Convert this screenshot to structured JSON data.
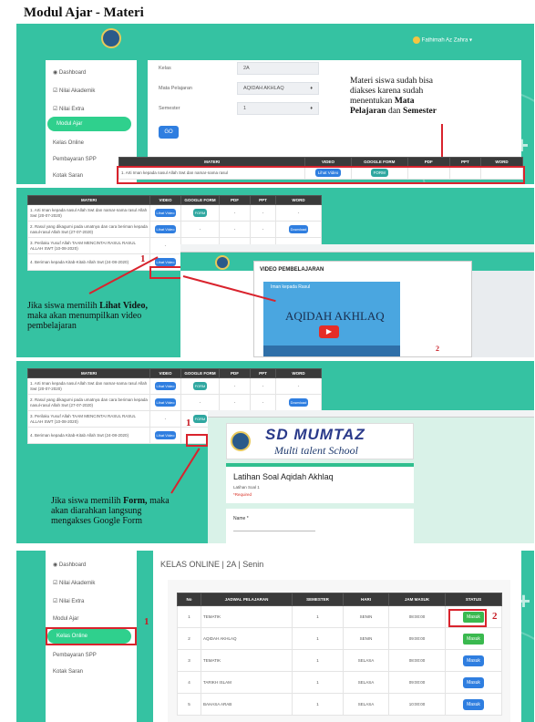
{
  "doc_title": "Modul Ajar - Materi",
  "panel1": {
    "user_name": "Fathimah Az Zahra",
    "sidebar": [
      "Dashboard",
      "Nilai Akademik",
      "Nilai Extra",
      "Modul Ajar",
      "Kelas Online",
      "Pembayaran SPP",
      "Kotak Saran"
    ],
    "fields": {
      "kelas_label": "Kelas",
      "kelas_value": "2A",
      "mapel_label": "Mata Pelajaran",
      "mapel_value": "AQIDAH AKHLAQ",
      "semester_label": "Semester",
      "semester_value": "1"
    },
    "go_label": "GO",
    "caption_line1": "Materi siswa sudah bisa",
    "caption_line2": "diakses karena sudah",
    "caption_line3": "menentukan",
    "caption_bold1": "Mata",
    "caption_bold2": "Pelajaran",
    "caption_dan": "dan",
    "caption_bold3": "Semester",
    "table_headers": [
      "MATERI",
      "VIDEO",
      "GOOGLE FORM",
      "PDF",
      "PPT",
      "WORD"
    ],
    "row1_materi": "1. Arti Iman kepada nasul Allah Swt dan namar-nama rasul",
    "row1_video": "Lihat Video",
    "row1_form": "FORM"
  },
  "panel2": {
    "table_headers": [
      "MATERI",
      "VIDEO",
      "GOOGLE FORM",
      "PDF",
      "PPT",
      "WORD"
    ],
    "rows": [
      {
        "materi": "1. Arti Iman kepada nasul Allah Swt dan namar-nama rasul Allah Swt (20-07-2020)",
        "video": "Lihat Video",
        "form": "FORM",
        "pdf": "-",
        "ppt": "-",
        "word": "-"
      },
      {
        "materi": "2. Rasul yang dikagumi pada umatnya dan cara beriman kepada nasul-rasul Allah Swt (27-07-2020)",
        "video": "Lihat Video",
        "form": "-",
        "pdf": "-",
        "ppt": "-",
        "word": "Download"
      },
      {
        "materi": "3. Perilaku Yusuf Allah TAAM MENCINTAI RASUL RASUL ALLAH SWT (10-08-2020)",
        "video": "-",
        "form": "-",
        "pdf": "-",
        "ppt": "-",
        "word": "-"
      },
      {
        "materi": "4. Beriman kepada Kitab-Kitab Allah Swt (24-08-2020)",
        "video": "Lihat Video",
        "form": "-",
        "pdf": "-",
        "ppt": "-",
        "word": "-"
      }
    ],
    "marker": "1",
    "marker2": "2",
    "popup_title": "VIDEO PEMBELAJARAN",
    "video_channel": "Iman kepada Rasul",
    "video_text": "AQIDAH AKHLAQ",
    "caption_pre": "Jika siswa memilih",
    "caption_bold": "Lihat Video,",
    "caption_line2": "maka akan menumpilkan video",
    "caption_line3": "pembelajaran"
  },
  "panel3": {
    "marker": "1",
    "form_button": "FORM",
    "school_name_1": "SD MUMTAZ",
    "school_name_2": "Multi talent School",
    "form_title": "Latihan Soal Aqidah Akhlaq",
    "form_sub": "Latihan Soal 1",
    "form_required": "*Required",
    "form_name_label": "Name *",
    "caption_pre": "Jika siswa memilih",
    "caption_bold": "Form,",
    "caption_post": "maka",
    "caption_line2": "akan diarahkan langsung",
    "caption_line3": "mengakses Google Form"
  },
  "panel4": {
    "title": "KELAS ONLINE | 2A | Senin",
    "sidebar": [
      "Dashboard",
      "Nilai Akademik",
      "Nilai Extra",
      "Modul Ajar",
      "Kelas Online",
      "Pembayaran SPP",
      "Kotak Saran"
    ],
    "marker1": "1",
    "marker2": "2",
    "table_headers": [
      "No",
      "JADWAL PELAJARAN",
      "SEMESTER",
      "HARI",
      "JAM MASUK",
      "STATUS"
    ],
    "rows": [
      {
        "no": "1",
        "mapel": "TEMATIK",
        "semester": "1",
        "hari": "SENIN",
        "jam": "08:00:00",
        "status": "Masuk"
      },
      {
        "no": "2",
        "mapel": "AQIDAH AKHLAQ",
        "semester": "1",
        "hari": "SENIN",
        "jam": "09:00:00",
        "status": "Masuk"
      },
      {
        "no": "3",
        "mapel": "TEMATIK",
        "semester": "1",
        "hari": "SELASA",
        "jam": "08:00:00",
        "status": "Masuk"
      },
      {
        "no": "4",
        "mapel": "TARIKH ISLAM",
        "semester": "1",
        "hari": "SELASA",
        "jam": "09:00:00",
        "status": "Masuk"
      },
      {
        "no": "5",
        "mapel": "BAHASA ARAB",
        "semester": "1",
        "hari": "SELASA",
        "jam": "10:00:00",
        "status": "Masuk"
      }
    ]
  }
}
